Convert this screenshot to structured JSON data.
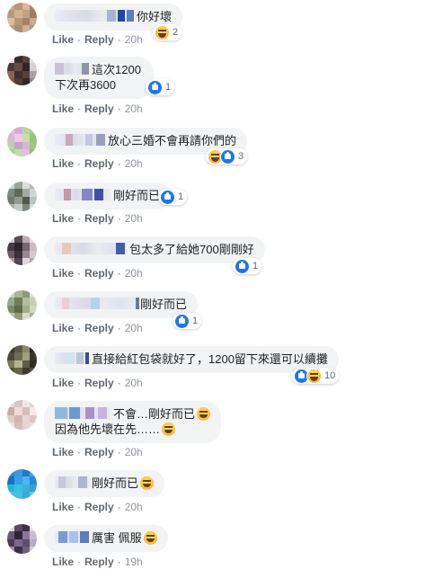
{
  "actions": {
    "like": "Like",
    "reply": "Reply",
    "separator": "·"
  },
  "comments": [
    {
      "text": "你好壞",
      "time": "20h",
      "reactions": [
        "haha"
      ],
      "count": "2"
    },
    {
      "text": "這次1200",
      "text2": "下次再3600",
      "time": "20h",
      "reactions": [
        "like"
      ],
      "count": "1"
    },
    {
      "text": "放心三婚不會再請你們的",
      "time": "20h",
      "reactions": [
        "haha",
        "like"
      ],
      "count": "3"
    },
    {
      "text": "剛好而已",
      "time": "20h",
      "reactions": [
        "like"
      ],
      "count": "1"
    },
    {
      "text": "包太多了給她700剛剛好",
      "time": "20h",
      "reactions": [
        "like"
      ],
      "count": "1"
    },
    {
      "text": "剛好而已",
      "time": "20h",
      "reactions": [
        "like"
      ],
      "count": "1"
    },
    {
      "text": "直接給紅包袋就好了，1200留下來還可以續攤",
      "time": "20h",
      "reactions": [
        "like",
        "haha"
      ],
      "count": "10"
    },
    {
      "text": "不會…剛好而已",
      "text2": "因為他先壞在先……",
      "time": "20h",
      "emoji": "laughing-emoji",
      "emoji2": "smiling-emoji"
    },
    {
      "text": "剛好而已",
      "time": "20h",
      "emoji": "laughing-emoji"
    },
    {
      "text": "厲害 佩服",
      "time": "19h",
      "emoji": "laughing-emoji"
    }
  ]
}
